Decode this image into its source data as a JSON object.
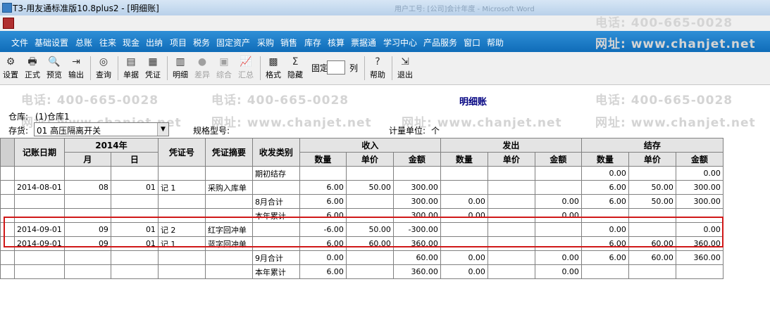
{
  "window": {
    "title": "T3-用友通标准版10.8plus2 - [明细账]",
    "ghost_text": "用户工号: [公司]会计年度 - Microsoft Word"
  },
  "menu": [
    "文件",
    "基础设置",
    "总账",
    "往来",
    "现金",
    "出纳",
    "项目",
    "税务",
    "固定资产",
    "采购",
    "销售",
    "库存",
    "核算",
    "票据通",
    "学习中心",
    "产品服务",
    "窗口",
    "帮助"
  ],
  "toolbar": {
    "setup": "设置",
    "official": "正式",
    "preview": "预览",
    "output": "输出",
    "query": "查询",
    "document": "单据",
    "voucher": "凭证",
    "detail": "明细",
    "difference": "差异",
    "summary": "综合",
    "total": "汇总",
    "format": "格式",
    "hide": "隐藏",
    "fix_label": "固定",
    "col_label": "列",
    "help": "帮助",
    "exit": "退出"
  },
  "watermark": {
    "phone": "电话: 400-665-0028",
    "site": "网址: www.chanjet.net"
  },
  "report": {
    "title": "明细账",
    "warehouse_label": "仓库:",
    "warehouse_value": "(1)仓库1",
    "stock_label": "存货:",
    "stock_value": "01 高压隔离开关",
    "spec_label": "规格型号:",
    "unit_label": "计量单位:",
    "unit_value": "个"
  },
  "table": {
    "headers": {
      "date": "记账日期",
      "year": "2014年",
      "month": "月",
      "day": "日",
      "voucher_no": "凭证号",
      "summary": "凭证摘要",
      "category": "收发类别",
      "in": "收入",
      "out": "发出",
      "balance": "结存",
      "qty": "数量",
      "price": "单价",
      "amount": "金额"
    },
    "rows": [
      {
        "date": "",
        "month": "",
        "day": "",
        "voucher": "",
        "summary": "",
        "cat": "期初结存",
        "in_q": "",
        "in_p": "",
        "in_a": "",
        "out_q": "",
        "out_p": "",
        "out_a": "",
        "bal_q": "0.00",
        "bal_p": "",
        "bal_a": "0.00"
      },
      {
        "date": "2014-08-01",
        "month": "08",
        "day": "01",
        "voucher": "记 1",
        "summary": "采购入库单",
        "cat": "",
        "in_q": "6.00",
        "in_p": "50.00",
        "in_a": "300.00",
        "out_q": "",
        "out_p": "",
        "out_a": "",
        "bal_q": "6.00",
        "bal_p": "50.00",
        "bal_a": "300.00"
      },
      {
        "date": "",
        "month": "",
        "day": "",
        "voucher": "",
        "summary": "",
        "cat": "8月合计",
        "in_q": "6.00",
        "in_p": "",
        "in_a": "300.00",
        "out_q": "0.00",
        "out_p": "",
        "out_a": "0.00",
        "bal_q": "6.00",
        "bal_p": "50.00",
        "bal_a": "300.00"
      },
      {
        "date": "",
        "month": "",
        "day": "",
        "voucher": "",
        "summary": "",
        "cat": "本年累计",
        "in_q": "6.00",
        "in_p": "",
        "in_a": "300.00",
        "out_q": "0.00",
        "out_p": "",
        "out_a": "0.00",
        "bal_q": "",
        "bal_p": "",
        "bal_a": ""
      },
      {
        "date": "2014-09-01",
        "month": "09",
        "day": "01",
        "voucher": "记 2",
        "summary": "红字回冲单",
        "cat": "",
        "in_q": "-6.00",
        "in_p": "50.00",
        "in_a": "-300.00",
        "out_q": "",
        "out_p": "",
        "out_a": "",
        "bal_q": "0.00",
        "bal_p": "",
        "bal_a": "0.00"
      },
      {
        "date": "2014-09-01",
        "month": "09",
        "day": "01",
        "voucher": "记 1",
        "summary": "蓝字回冲单",
        "cat": "",
        "in_q": "6.00",
        "in_p": "60.00",
        "in_a": "360.00",
        "out_q": "",
        "out_p": "",
        "out_a": "",
        "bal_q": "6.00",
        "bal_p": "60.00",
        "bal_a": "360.00"
      },
      {
        "date": "",
        "month": "",
        "day": "",
        "voucher": "",
        "summary": "",
        "cat": "9月合计",
        "in_q": "0.00",
        "in_p": "",
        "in_a": "60.00",
        "out_q": "0.00",
        "out_p": "",
        "out_a": "0.00",
        "bal_q": "6.00",
        "bal_p": "60.00",
        "bal_a": "360.00"
      },
      {
        "date": "",
        "month": "",
        "day": "",
        "voucher": "",
        "summary": "",
        "cat": "本年累计",
        "in_q": "6.00",
        "in_p": "",
        "in_a": "360.00",
        "out_q": "0.00",
        "out_p": "",
        "out_a": "0.00",
        "bal_q": "",
        "bal_p": "",
        "bal_a": ""
      }
    ]
  },
  "colors": {
    "menubar": "#1f7fc9",
    "highlight_box": "#d01818",
    "title": "#000080"
  }
}
